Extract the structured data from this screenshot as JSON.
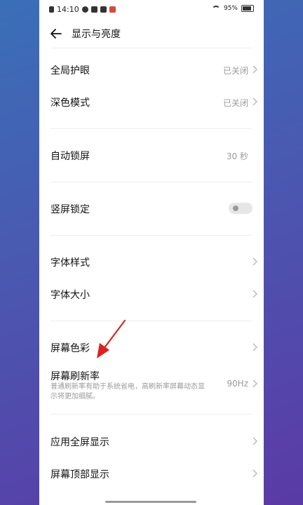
{
  "statusbar": {
    "time": "14:10",
    "battery": "95%"
  },
  "header": {
    "title": "显示与亮度"
  },
  "settings": {
    "eye_protection": {
      "label": "全局护眼",
      "value": "已关闭"
    },
    "dark_mode": {
      "label": "深色模式",
      "value": "已关闭"
    },
    "auto_lock": {
      "label": "自动锁屏",
      "value": "30 秒"
    },
    "portrait_lock": {
      "label": "竖屏锁定"
    },
    "font_style": {
      "label": "字体样式"
    },
    "font_size": {
      "label": "字体大小"
    },
    "screen_color": {
      "label": "屏幕色彩"
    },
    "refresh_rate": {
      "label": "屏幕刷新率",
      "description": "普通刷新率有助于系统省电，高刷新率屏幕动态显示将更加细腻。",
      "value": "90Hz"
    },
    "app_fullscreen": {
      "label": "应用全屏显示"
    },
    "top_display": {
      "label": "屏幕顶部显示"
    }
  },
  "colors": {
    "annotation_arrow": "#e02020",
    "accent_bg_top": "#3a6fb7",
    "accent_bg_bottom": "#5b3aa6"
  }
}
